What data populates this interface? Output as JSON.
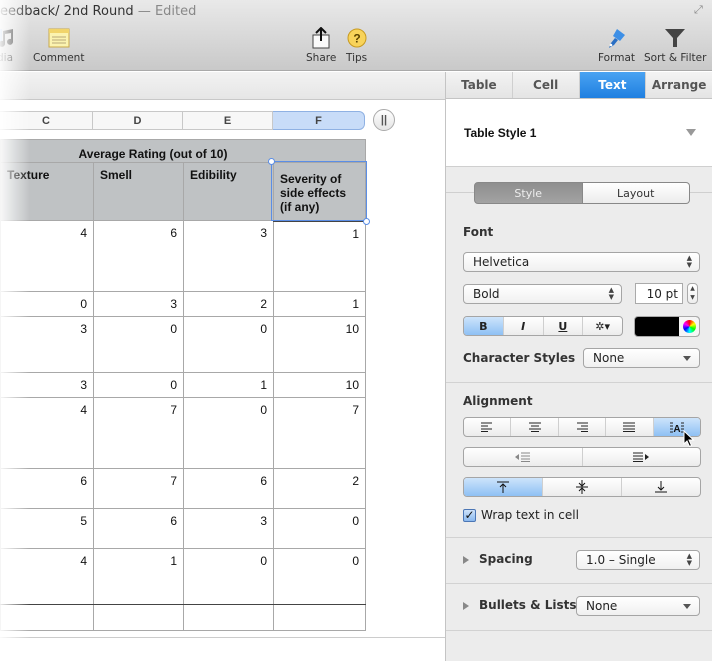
{
  "window": {
    "title": "eedback/ 2nd Round",
    "edited": "— Edited"
  },
  "toolbar": {
    "items": [
      {
        "label": "dia",
        "icon": "media-icon"
      },
      {
        "label": "Comment",
        "icon": "comment-icon"
      },
      {
        "label": "Share",
        "icon": "share-icon"
      },
      {
        "label": "Tips",
        "icon": "tips-icon"
      },
      {
        "label": "Format",
        "icon": "format-brush-icon"
      },
      {
        "label": "Sort & Filter",
        "icon": "funnel-icon"
      }
    ]
  },
  "sheet": {
    "columns": [
      "C",
      "D",
      "E",
      "F"
    ],
    "selected_column": "F",
    "group_header": "Average Rating (out of 10)",
    "headers": [
      "Texture",
      "Smell",
      "Edibility",
      "Severity of side effects (if any)"
    ],
    "rows": [
      [
        "4",
        "6",
        "3",
        "1"
      ],
      [
        "0",
        "3",
        "2",
        "1"
      ],
      [
        "3",
        "0",
        "0",
        "10"
      ],
      [
        "3",
        "0",
        "1",
        "10"
      ],
      [
        "4",
        "7",
        "0",
        "7"
      ],
      [
        "6",
        "7",
        "6",
        "2"
      ],
      [
        "5",
        "6",
        "3",
        "0"
      ],
      [
        "4",
        "1",
        "0",
        "0"
      ],
      [
        "",
        "",
        "",
        ""
      ]
    ]
  },
  "inspector": {
    "tabs": [
      "Table",
      "Cell",
      "Text",
      "Arrange"
    ],
    "active_tab": "Text",
    "table_style": "Table Style 1",
    "segments": [
      "Style",
      "Layout"
    ],
    "font_label": "Font",
    "font_family": "Helvetica",
    "font_style": "Bold",
    "font_size": "10 pt",
    "format_buttons": [
      "B",
      "I",
      "U",
      "✲▾"
    ],
    "character_styles_label": "Character Styles",
    "character_styles_value": "None",
    "alignment_label": "Alignment",
    "wrap_label": "Wrap text in cell",
    "wrap_checked": true,
    "spacing_label": "Spacing",
    "spacing_value": "1.0 – Single",
    "bullets_label": "Bullets & Lists",
    "bullets_value": "None",
    "text_color": "#000000",
    "accent_color": "#1f7fe0"
  }
}
